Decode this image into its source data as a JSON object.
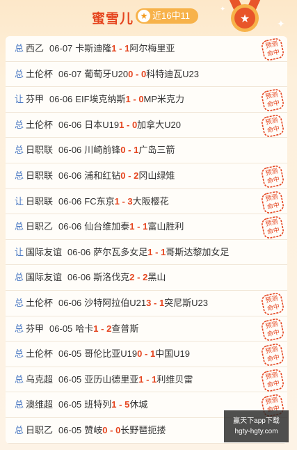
{
  "header": {
    "title": "蜜雪儿",
    "record": "近16中11"
  },
  "colors": {
    "accent": "#e5451f",
    "tag": "#4a78c2",
    "badge": "#f7b24a"
  },
  "matches": [
    {
      "tag": "总",
      "league": "西乙",
      "date": "06-07",
      "home": "卡斯迪隆",
      "home_score": "1",
      "away_score": "1",
      "away": "阿尔梅里亚",
      "hit": true
    },
    {
      "tag": "总",
      "league": "土伦杯",
      "date": "06-07",
      "home": "葡萄牙U20",
      "home_score": "0",
      "away_score": "0",
      "away": "科特迪瓦U23",
      "hit": false
    },
    {
      "tag": "让",
      "league": "芬甲",
      "date": "06-06",
      "home": "EIF埃克纳斯",
      "home_score": "1",
      "away_score": "0",
      "away": "MP米克力",
      "hit": true
    },
    {
      "tag": "总",
      "league": "土伦杯",
      "date": "06-06",
      "home": "日本U19",
      "home_score": "1",
      "away_score": "0",
      "away": "加拿大U20",
      "hit": true
    },
    {
      "tag": "总",
      "league": "日职联",
      "date": "06-06",
      "home": "川崎前锋",
      "home_score": "0",
      "away_score": "1",
      "away": "广岛三箭",
      "hit": false
    },
    {
      "tag": "总",
      "league": "日职联",
      "date": "06-06",
      "home": "浦和红钻",
      "home_score": "0",
      "away_score": "2",
      "away": "冈山绿雉",
      "hit": true
    },
    {
      "tag": "让",
      "league": "日职联",
      "date": "06-06",
      "home": "FC东京",
      "home_score": "1",
      "away_score": "3",
      "away": "大阪樱花",
      "hit": true
    },
    {
      "tag": "总",
      "league": "日职乙",
      "date": "06-06",
      "home": "仙台维加泰",
      "home_score": "1",
      "away_score": "1",
      "away": "富山胜利",
      "hit": true
    },
    {
      "tag": "让",
      "league": "国际友谊",
      "date": "06-06",
      "home": "萨尔瓦多女足",
      "home_score": "1",
      "away_score": "1",
      "away": "哥斯达黎加女足",
      "hit": false
    },
    {
      "tag": "总",
      "league": "国际友谊",
      "date": "06-06",
      "home": "斯洛伐克",
      "home_score": "2",
      "away_score": "2",
      "away": "黑山",
      "hit": false
    },
    {
      "tag": "总",
      "league": "土伦杯",
      "date": "06-06",
      "home": "沙特阿拉伯U21",
      "home_score": "3",
      "away_score": "1",
      "away": "突尼斯U23",
      "hit": true
    },
    {
      "tag": "总",
      "league": "芬甲",
      "date": "06-05",
      "home": "哈卡",
      "home_score": "1",
      "away_score": "2",
      "away": "查普斯",
      "hit": true
    },
    {
      "tag": "总",
      "league": "土伦杯",
      "date": "06-05",
      "home": "哥伦比亚U19",
      "home_score": "0",
      "away_score": "1",
      "away": "中国U19",
      "hit": true
    },
    {
      "tag": "总",
      "league": "乌克超",
      "date": "06-05",
      "home": "亚历山德里亚",
      "home_score": "1",
      "away_score": "1",
      "away": "利维贝雷",
      "hit": true
    },
    {
      "tag": "总",
      "league": "澳维超",
      "date": "06-05",
      "home": "班特列",
      "home_score": "1",
      "away_score": "5",
      "away": "休城",
      "hit": true
    },
    {
      "tag": "总",
      "league": "日职乙",
      "date": "06-05",
      "home": "赞岐",
      "home_score": "0",
      "away_score": "0",
      "away": "长野琶扼搂",
      "hit": false
    }
  ],
  "stamp_text": [
    "预测",
    "命中"
  ],
  "watermark": {
    "line1": "赢天下app下载",
    "line2": "hgty-hgty.com"
  }
}
